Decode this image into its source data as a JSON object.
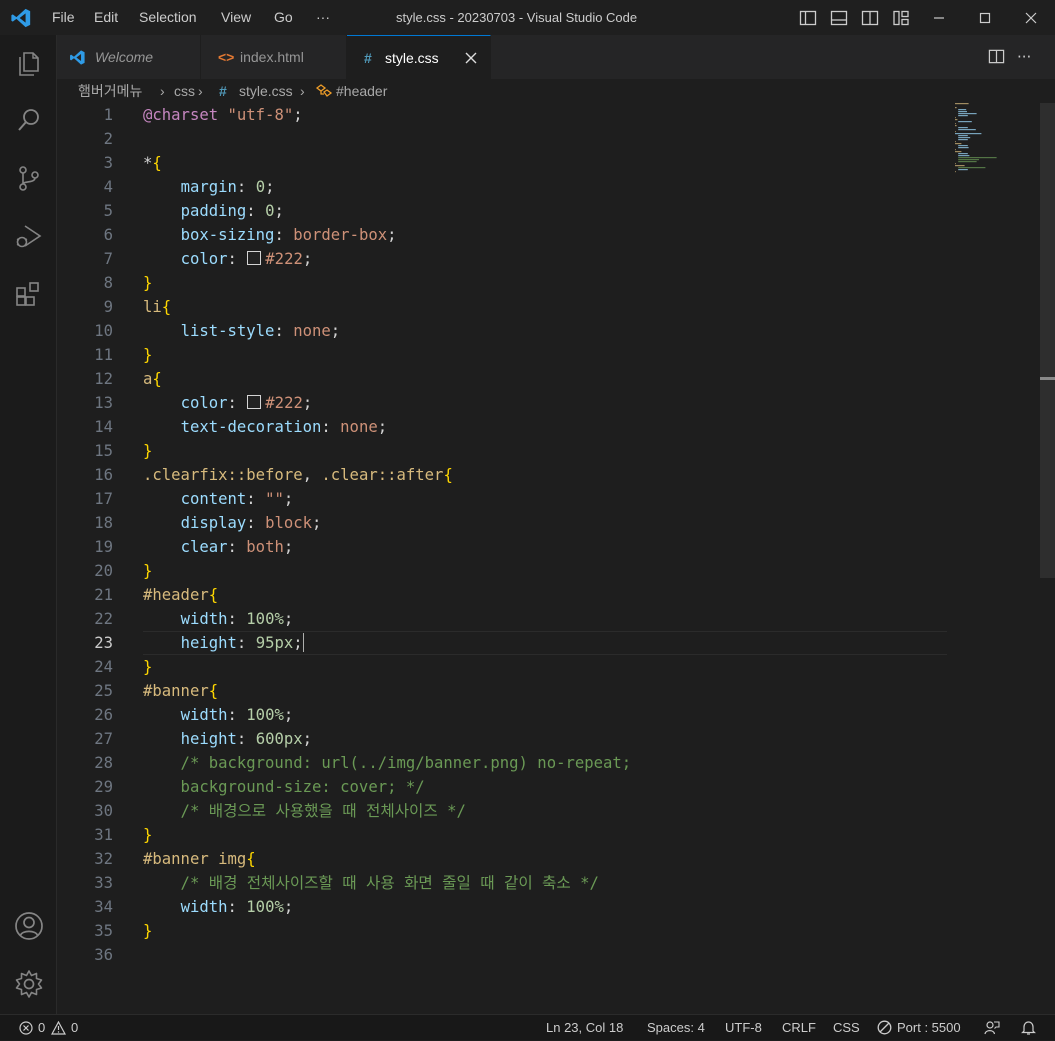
{
  "titlebar": {
    "menu": [
      "File",
      "Edit",
      "Selection",
      "View",
      "Go",
      "···"
    ],
    "window_title": "style.css - 20230703 - Visual Studio Code"
  },
  "tabs": [
    {
      "label": "Welcome",
      "icon": "vscode-logo-icon",
      "active": false
    },
    {
      "label": "index.html",
      "icon": "html-icon",
      "active": false
    },
    {
      "label": "style.css",
      "icon": "#",
      "active": true
    }
  ],
  "breadcrumb": {
    "folder": "햄버거메뉴",
    "subfolder": "css",
    "file": "style.css",
    "symbol": "#header"
  },
  "editor": {
    "current_line": 23,
    "lines": [
      "@charset \"utf-8\";",
      "",
      "*{",
      "    margin: 0;",
      "    padding: 0;",
      "    box-sizing: border-box;",
      "    color: #222;",
      "}",
      "li{",
      "    list-style: none;",
      "}",
      "a{",
      "    color: #222;",
      "    text-decoration: none;",
      "}",
      ".clearfix::before, .clear::after{",
      "    content: \"\";",
      "    display: block;",
      "    clear: both;",
      "}",
      "#header{",
      "    width: 100%;",
      "    height: 95px;",
      "}",
      "#banner{",
      "    width: 100%;",
      "    height: 600px;",
      "    /* background: url(../img/banner.png) no-repeat;",
      "    background-size: cover; */",
      "    /* 배경으로 사용했을 때 전체사이즈 */",
      "}",
      "#banner img{",
      "    /* 배경 전체사이즈할 때 사용 화면 줄일 때 같이 축소 */",
      "    width: 100%;",
      "}",
      ""
    ]
  },
  "statusbar": {
    "errors": "0",
    "warnings": "0",
    "position": "Ln 23, Col 18",
    "spaces": "Spaces: 4",
    "encoding": "UTF-8",
    "eol": "CRLF",
    "language": "CSS",
    "port": "Port : 5500"
  },
  "colors": {
    "accent": "#0078d4",
    "editor_bg": "#1e1e1e",
    "keyword": "#c586c0",
    "property": "#9cdcfe",
    "value": "#ce9178",
    "number": "#b5cea8",
    "selector": "#d7ba7d",
    "comment": "#6a9955",
    "brace": "#ffd700"
  }
}
